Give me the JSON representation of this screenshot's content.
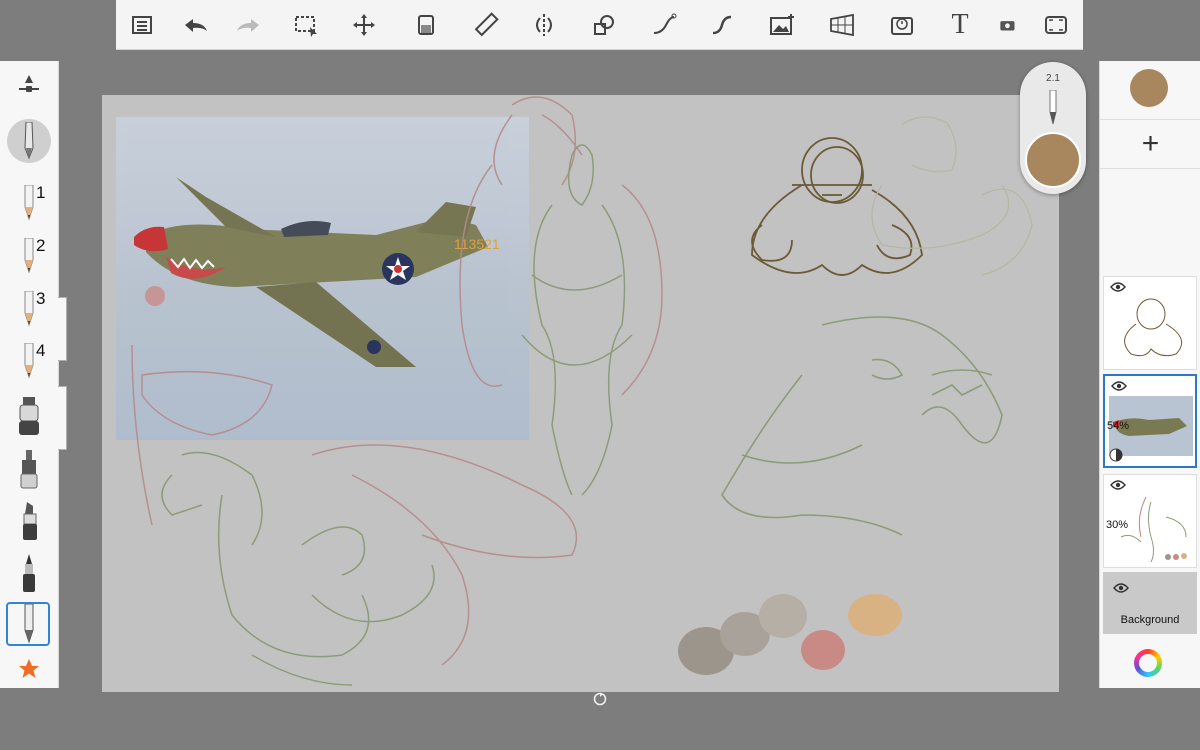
{
  "toolbar": {
    "items": [
      {
        "name": "layers-menu-icon"
      },
      {
        "name": "undo-icon"
      },
      {
        "name": "redo-icon"
      },
      {
        "name": "selection-icon"
      },
      {
        "name": "transform-icon"
      },
      {
        "name": "fill-icon"
      },
      {
        "name": "ruler-icon"
      },
      {
        "name": "symmetry-icon"
      },
      {
        "name": "shapes-icon"
      },
      {
        "name": "stroke-icon"
      },
      {
        "name": "curve-icon"
      },
      {
        "name": "add-image-icon"
      },
      {
        "name": "perspective-icon"
      },
      {
        "name": "time-lapse-icon"
      },
      {
        "name": "text-icon",
        "label": "T"
      },
      {
        "name": "camera-icon"
      },
      {
        "name": "fullscreen-icon"
      }
    ]
  },
  "left_tools": {
    "brushes": [
      {
        "name": "pencil-tool-1",
        "label": "1"
      },
      {
        "name": "pencil-tool-2",
        "label": "2"
      },
      {
        "name": "pencil-tool-3",
        "label": "3"
      },
      {
        "name": "pencil-tool-4",
        "label": "4"
      }
    ]
  },
  "puck": {
    "size": "2.1",
    "color": "#a8875f"
  },
  "layers": {
    "current_color": "#a8875f",
    "items": [
      {
        "name": "layer-sketch-top",
        "opacity": ""
      },
      {
        "name": "layer-photo",
        "opacity": "54%"
      },
      {
        "name": "layer-sketch-color",
        "opacity": "30%"
      },
      {
        "name": "layer-background",
        "label": "Background"
      }
    ]
  },
  "canvas": {
    "airplane_number": "113521",
    "swatches": [
      "#9c958c",
      "#a8a29a",
      "#b5afa6",
      "#c98a86",
      "#d9b283"
    ]
  }
}
